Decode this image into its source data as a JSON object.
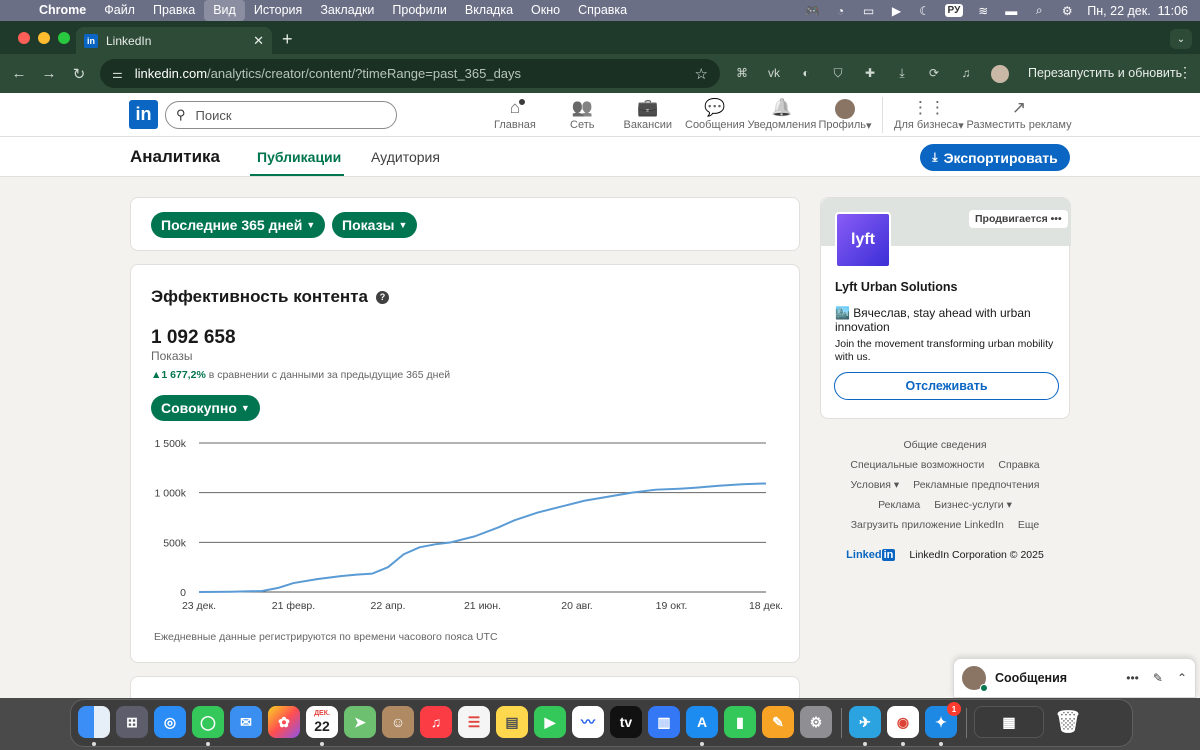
{
  "menubar": {
    "app": "Chrome",
    "items": [
      "Файл",
      "Правка",
      "Вид",
      "История",
      "Закладки",
      "Профили",
      "Вкладка",
      "Окно",
      "Справка"
    ],
    "active_item": "Вид",
    "lang": "РУ",
    "datetime": "Пн, 22 дек.  11:06"
  },
  "browser": {
    "tab_title": "LinkedIn",
    "url_host": "linkedin.com",
    "url_path": "/analytics/creator/content/?timeRange=past_365_days",
    "relaunch_label": "Перезапустить и обновить",
    "ext_icons": [
      "extension-a-icon",
      "vk-icon",
      "extension-c-icon",
      "shield-icon",
      "puzzle-icon",
      "download-icon",
      "sync-icon",
      "media-icon"
    ]
  },
  "linkedin": {
    "logo": "in",
    "search_placeholder": "Поиск",
    "nav": [
      {
        "label": "Главная",
        "icon": "home-icon"
      },
      {
        "label": "Сеть",
        "icon": "network-icon"
      },
      {
        "label": "Вакансии",
        "icon": "jobs-icon"
      },
      {
        "label": "Сообщения",
        "icon": "messaging-icon"
      },
      {
        "label": "Уведомления",
        "icon": "bell-icon"
      },
      {
        "label": "Профиль",
        "icon": "avatar"
      },
      {
        "label": "Для бизнеса",
        "icon": "grid-icon"
      },
      {
        "label": "Разместить рекламу",
        "icon": "advertise-icon"
      }
    ]
  },
  "analytics": {
    "title": "Аналитика",
    "tabs": [
      "Публикации",
      "Аудитория"
    ],
    "export_label": "Экспортировать",
    "filters": {
      "range": "Последние 365 дней",
      "metric": "Показы"
    },
    "performance": {
      "title": "Эффективность контента",
      "value": "1 092 658",
      "value_label": "Показы",
      "delta": "1 677,2%",
      "delta_text": "в сравнении с данными за предыдущие 365 дней",
      "mode_label": "Совокупно",
      "footnote": "Ежедневные данные регистрируются по времени часового пояса UTC"
    }
  },
  "chart_data": {
    "type": "line",
    "title": "",
    "xlabel": "",
    "ylabel": "",
    "x_ticks": [
      "23 дек.",
      "21 февр.",
      "22 апр.",
      "21 июн.",
      "20 авг.",
      "19 окт.",
      "18 дек."
    ],
    "y_ticks": [
      "0",
      "500k",
      "1 000k",
      "1 500k"
    ],
    "ylim": [
      0,
      1500000
    ],
    "grid": true,
    "color": "#5a9bd5",
    "series": [
      {
        "name": "",
        "x_days": [
          0,
          20,
          40,
          50,
          60,
          75,
          90,
          100,
          110,
          120,
          130,
          140,
          150,
          160,
          175,
          190,
          200,
          215,
          230,
          245,
          260,
          275,
          290,
          305,
          315,
          330,
          345,
          360
        ],
        "values": [
          0,
          2000,
          10000,
          40000,
          90000,
          130000,
          160000,
          175000,
          185000,
          250000,
          380000,
          450000,
          480000,
          500000,
          560000,
          650000,
          720000,
          800000,
          860000,
          920000,
          960000,
          1000000,
          1030000,
          1040000,
          1050000,
          1070000,
          1085000,
          1092658
        ]
      }
    ]
  },
  "ad": {
    "promoted_label": "Продвигается",
    "logo_text": "lyft",
    "company": "Lyft Urban Solutions",
    "headline": "🏙️ Вячеслав, stay ahead with urban innovation",
    "body": "Join the movement transforming urban mobility with us.",
    "follow_label": "Отслеживать"
  },
  "footer": {
    "rows": [
      [
        "Общие сведения"
      ],
      [
        "Специальные возможности",
        "Справка"
      ],
      [
        "Условия ▾",
        "Рекламные предпочтения"
      ],
      [
        "Реклама",
        "Бизнес-услуги ▾"
      ],
      [
        "Загрузить приложение LinkedIn",
        "Еще"
      ]
    ],
    "copyright_brand": "Linked",
    "copyright": "LinkedIn Corporation © 2025"
  },
  "messaging": {
    "title": "Сообщения"
  },
  "dock": {
    "calendar_month": "ДЕК.",
    "calendar_day": "22",
    "badge": "1"
  }
}
